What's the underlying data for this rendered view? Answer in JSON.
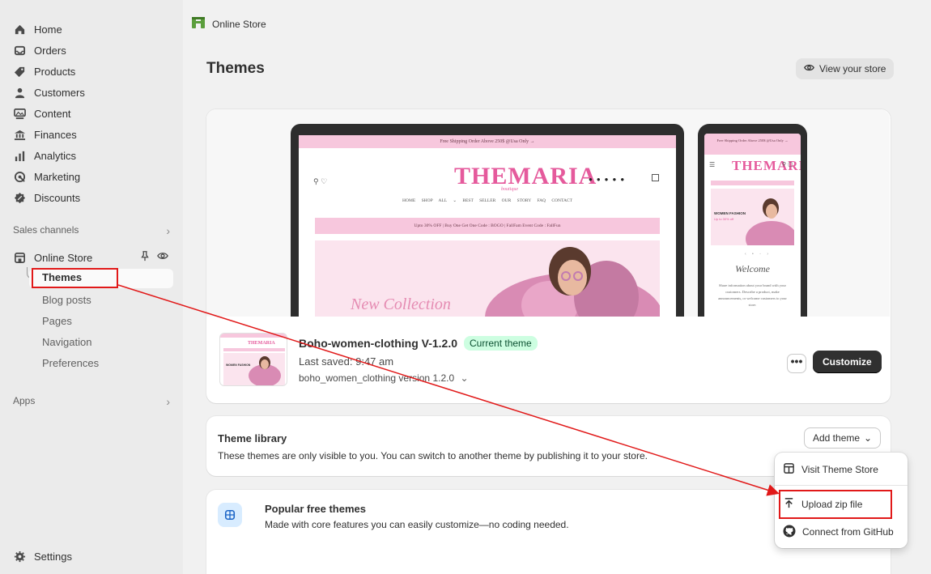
{
  "sidebar": {
    "items": [
      {
        "label": "Home",
        "icon": "home-icon"
      },
      {
        "label": "Orders",
        "icon": "inbox-icon"
      },
      {
        "label": "Products",
        "icon": "tag-icon"
      },
      {
        "label": "Customers",
        "icon": "person-icon"
      },
      {
        "label": "Content",
        "icon": "image-icon"
      },
      {
        "label": "Finances",
        "icon": "bank-icon"
      },
      {
        "label": "Analytics",
        "icon": "bar-chart-icon"
      },
      {
        "label": "Marketing",
        "icon": "target-icon"
      },
      {
        "label": "Discounts",
        "icon": "discount-icon"
      }
    ],
    "sales_channels_label": "Sales channels",
    "online_store_label": "Online Store",
    "sub_items": [
      "Themes",
      "Blog posts",
      "Pages",
      "Navigation",
      "Preferences"
    ],
    "apps_label": "Apps",
    "settings_label": "Settings"
  },
  "topbar": {
    "title": "Online Store"
  },
  "page": {
    "title": "Themes",
    "view_store_label": "View your store"
  },
  "preview": {
    "promo": "Free Shipping Order Above 250$ @Usa Only →",
    "brand": "THEMARIA",
    "brand_sub": "boutique",
    "menu": "HOME   SHOP ALL ⌄   BEST SELLER   OUR STORY   FAQ   CONTACT",
    "sale": "Upto 30% OFF | Buy One Get One Code : BOGO | FallFam Event Code : FallFun",
    "hero_text": "New Collection",
    "phone_promo": "Free Shipping Order Above 250$ @Usa Only →",
    "phone_fashion": "WOMEN FASHION",
    "phone_off": "Up to 30% off",
    "phone_welcome": "Welcome",
    "phone_copy": "Share information about your brand with your customers. Describe a product, make announcements, or welcome customers to your store."
  },
  "current_theme": {
    "name": "Boho-women-clothing V-1.2.0",
    "badge": "Current theme",
    "last_saved": "Last saved: 9:47 am",
    "version": "boho_women_clothing version 1.2.0",
    "more_label": "•••",
    "customize_label": "Customize"
  },
  "library": {
    "title": "Theme library",
    "description": "These themes are only visible to you. You can switch to another theme by publishing it to your store.",
    "add_theme_label": "Add theme"
  },
  "popular": {
    "title": "Popular free themes",
    "description": "Made with core features you can easily customize—no coding needed."
  },
  "dropdown": {
    "items": [
      {
        "label": "Visit Theme Store",
        "icon": "theme-store-icon"
      },
      {
        "label": "Upload zip file",
        "icon": "upload-icon"
      },
      {
        "label": "Connect from GitHub",
        "icon": "github-icon"
      }
    ]
  },
  "colors": {
    "annotation_red": "#e11919",
    "brand_pink": "#e55a9c",
    "badge_green": "#cdfee1"
  }
}
